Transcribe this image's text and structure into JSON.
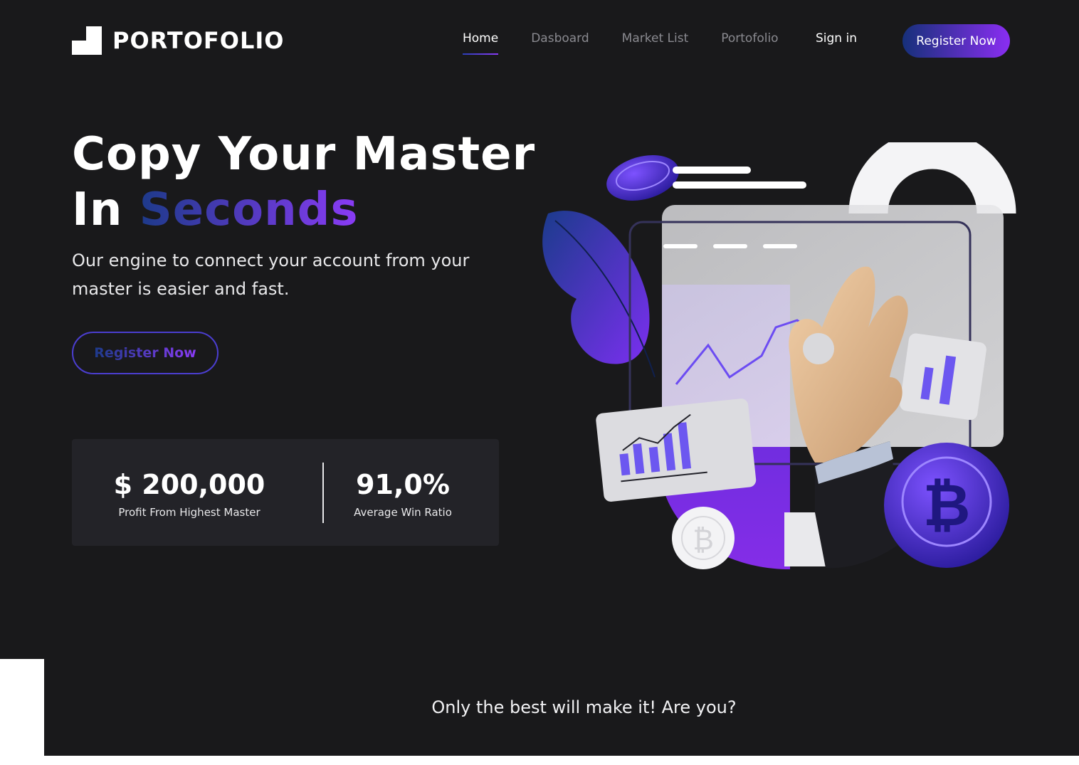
{
  "brand": {
    "name": "PORTOFOLIO"
  },
  "nav": {
    "items": [
      {
        "label": "Home",
        "active": true
      },
      {
        "label": "Dasboard",
        "active": false
      },
      {
        "label": "Market List",
        "active": false
      },
      {
        "label": "Portofolio",
        "active": false
      }
    ],
    "sign_in": "Sign in",
    "register": "Register Now"
  },
  "hero": {
    "title_line1": "Copy Your Master",
    "title_line2_plain": "In",
    "title_line2_accent": "Seconds",
    "subtitle": "Our engine to connect your account from your master is easier and fast.",
    "cta": "Register Now"
  },
  "stats": [
    {
      "value": "$ 200,000",
      "label": "Profit From Highest Master"
    },
    {
      "value": "91,0%",
      "label": "Average Win Ratio"
    }
  ],
  "tagline": "Only the best will make it! Are you?",
  "colors": {
    "background": "#19191b",
    "accent_start": "#16307a",
    "accent_end": "#8a2ef2"
  }
}
